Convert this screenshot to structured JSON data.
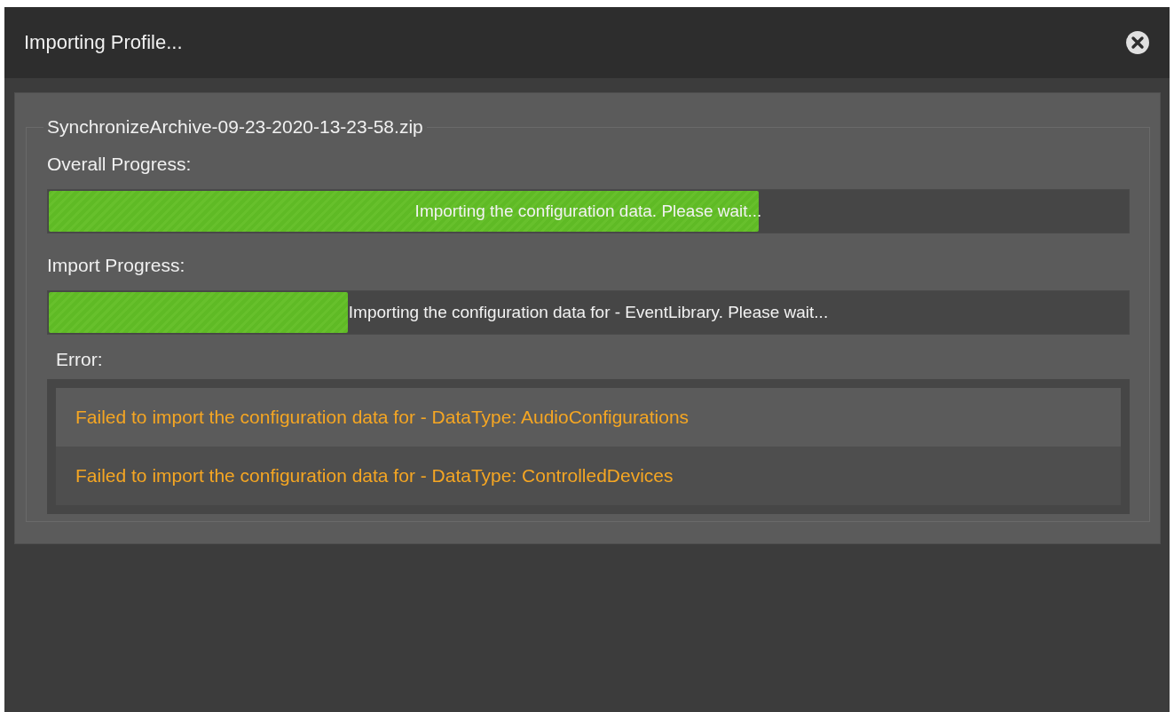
{
  "window": {
    "title": "Importing Profile..."
  },
  "group": {
    "title": "SynchronizeArchive-09-23-2020-13-23-58.zip"
  },
  "progress": [
    {
      "label": "Overall Progress:",
      "level": 0.657,
      "text": "Importing the configuration data. Please wait..."
    },
    {
      "label": "Import Progress:",
      "level": 0.277,
      "text": "Importing the configuration data for - EventLibrary. Please wait..."
    }
  ],
  "errors": {
    "label": "Error:",
    "items": [
      "Failed to import the configuration data for - DataType: AudioConfigurations",
      "Failed to import the configuration data for - DataType: ControlledDevices"
    ]
  }
}
